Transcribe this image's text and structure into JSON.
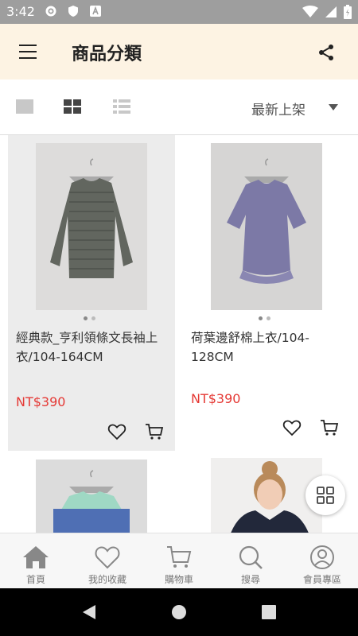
{
  "status_bar": {
    "time": "3:42"
  },
  "header": {
    "title": "商品分類"
  },
  "toolbar": {
    "sort_label": "最新上架"
  },
  "products": [
    {
      "name": "經典款_亨利領條文長袖上衣/104-164CM",
      "price": "NT$390"
    },
    {
      "name": "荷葉邊舒棉上衣/104-128CM",
      "price": "NT$390"
    }
  ],
  "bottom_nav": [
    {
      "label": "首頁",
      "icon": "home-icon"
    },
    {
      "label": "我的收藏",
      "icon": "heart-icon"
    },
    {
      "label": "購物車",
      "icon": "cart-icon"
    },
    {
      "label": "搜尋",
      "icon": "search-icon"
    },
    {
      "label": "會員專區",
      "icon": "user-icon"
    }
  ],
  "colors": {
    "header_bg": "#fdf3e3",
    "price": "#e53935",
    "selected_card": "#ececec"
  }
}
